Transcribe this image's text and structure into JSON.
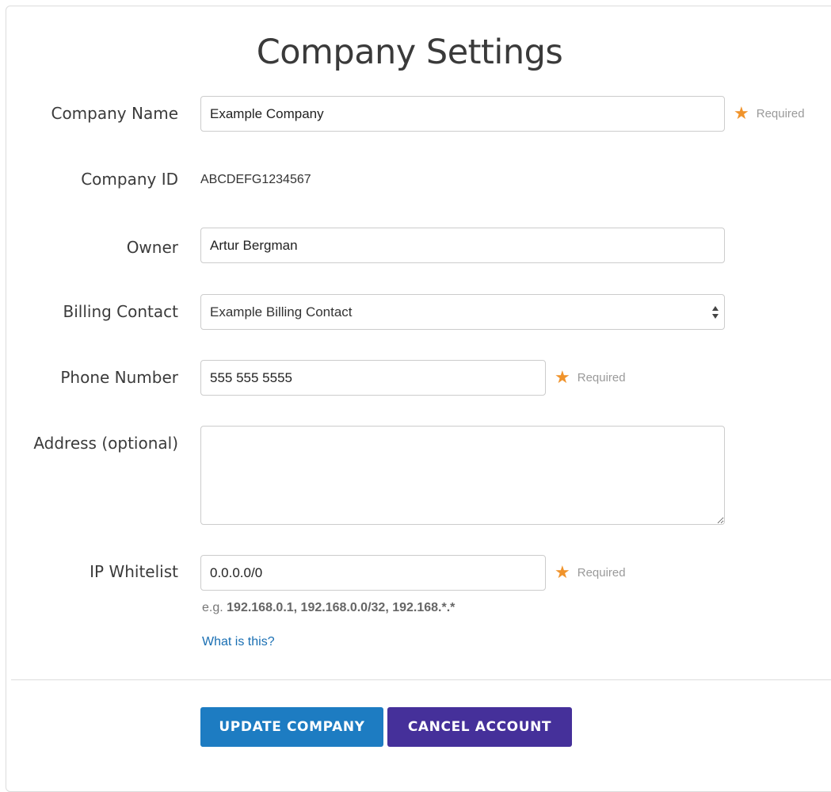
{
  "page": {
    "title": "Company Settings"
  },
  "form": {
    "company_name": {
      "label": "Company Name",
      "value": "Example Company",
      "required_text": "Required"
    },
    "company_id": {
      "label": "Company ID",
      "value": "ABCDEFG1234567"
    },
    "owner": {
      "label": "Owner",
      "value": "Artur Bergman"
    },
    "billing_contact": {
      "label": "Billing Contact",
      "selected": "Example Billing Contact"
    },
    "phone_number": {
      "label": "Phone Number",
      "value": "555 555 5555",
      "required_text": "Required"
    },
    "address": {
      "label": "Address (optional)",
      "value": ""
    },
    "ip_whitelist": {
      "label": "IP Whitelist",
      "value": "0.0.0.0/0",
      "required_text": "Required",
      "hint_prefix": "e.g. ",
      "hint_examples": "192.168.0.1, 192.168.0.0/32, 192.168.*.*",
      "help_link": "What is this?"
    }
  },
  "actions": {
    "update_label": "UPDATE COMPANY",
    "cancel_label": "CANCEL ACCOUNT"
  },
  "icons": {
    "required": "star-icon",
    "select": "updown-arrows-icon"
  },
  "colors": {
    "required_star": "#f0932b",
    "update_button": "#1d7cc2",
    "cancel_button": "#45309a",
    "link": "#1a6fb3"
  }
}
